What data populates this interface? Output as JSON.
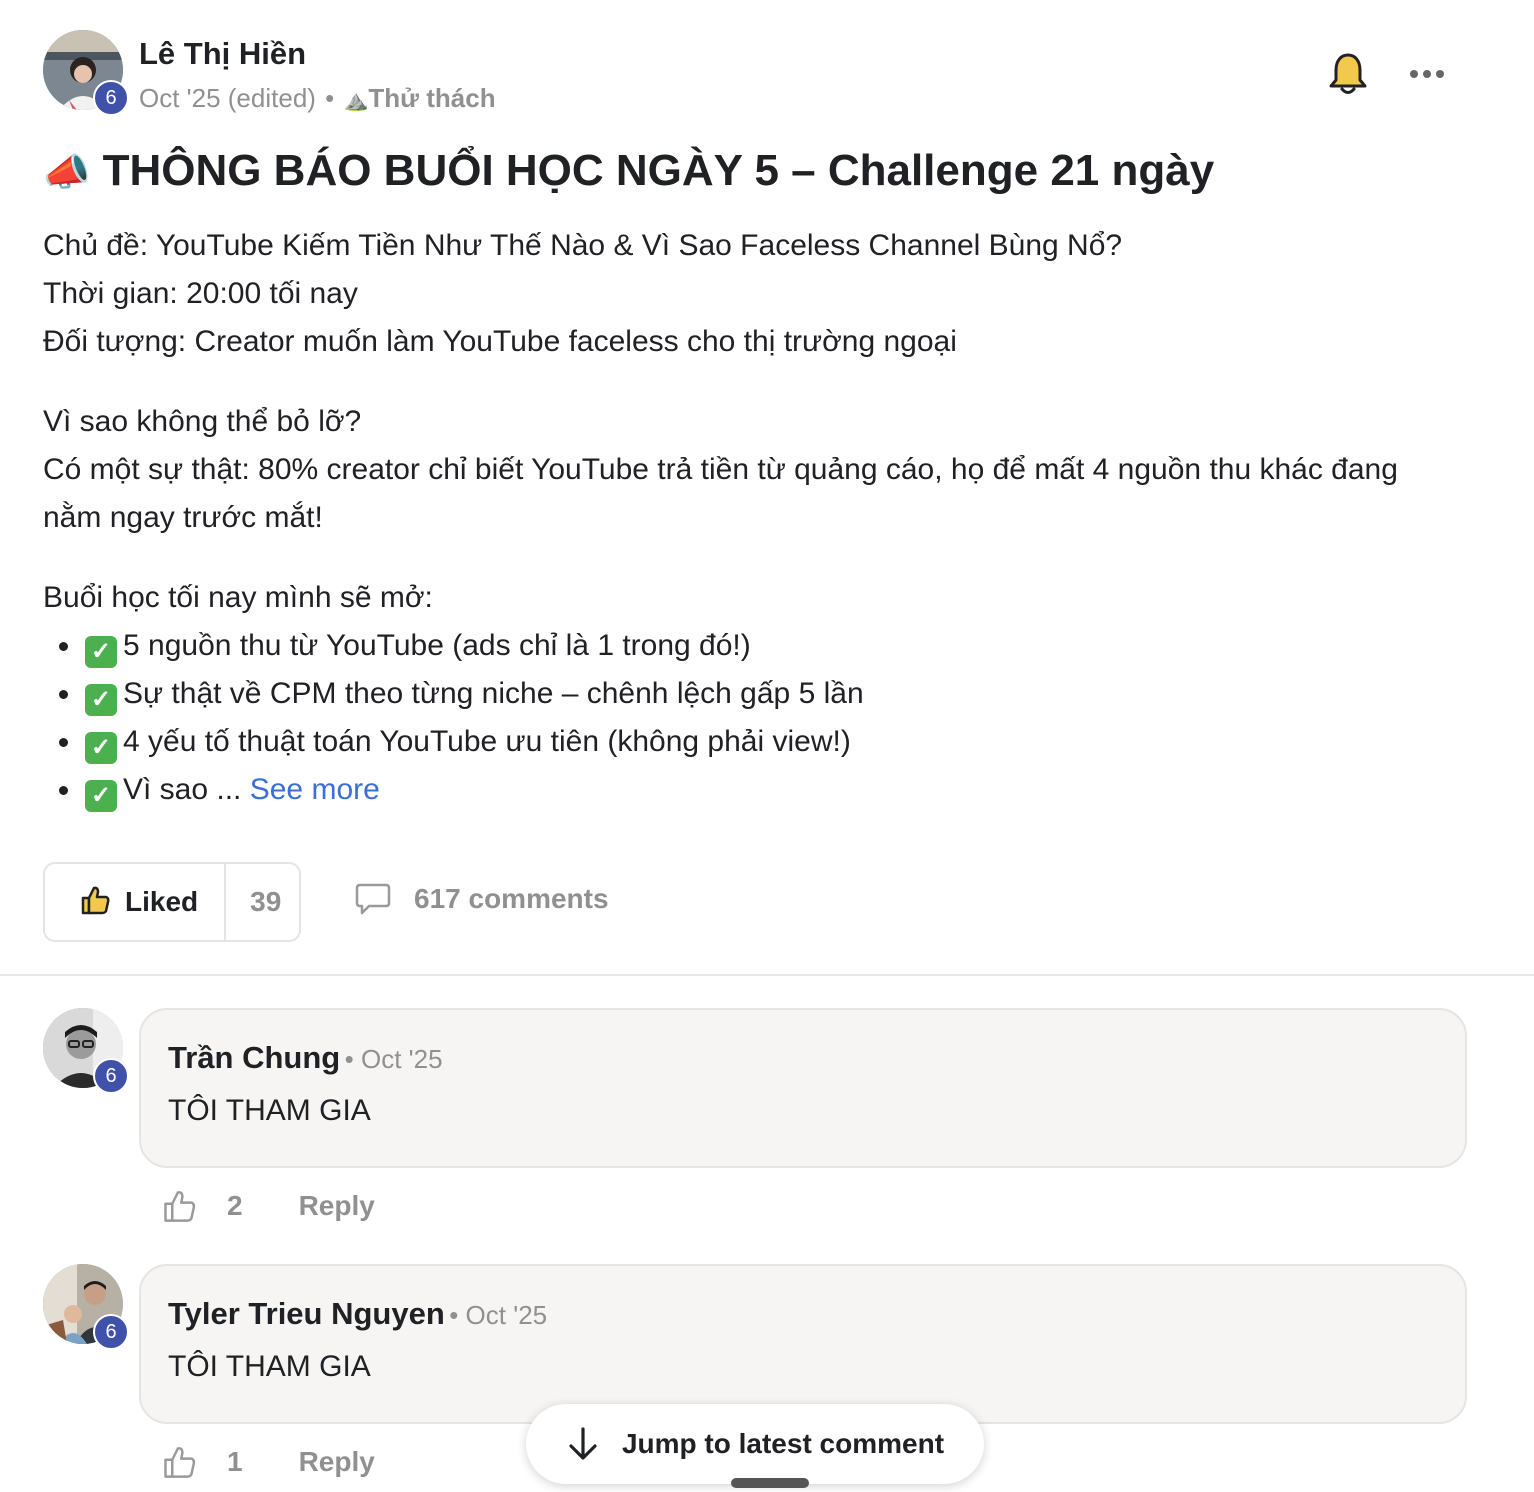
{
  "post": {
    "author": "Lê Thị Hiền",
    "level": "6",
    "date": "Oct '25 (edited)",
    "separator": "•",
    "category_icon": "⛰️",
    "category": "Thử thách",
    "title_icon": "📣",
    "title": "THÔNG BÁO BUỔI HỌC NGÀY 5 – Challenge 21 ngày",
    "lines": [
      "Chủ đề: YouTube Kiếm Tiền Như Thế Nào & Vì Sao Faceless Channel Bùng Nổ?",
      "Thời gian: 20:00 tối nay",
      "Đối tượng: Creator muốn làm YouTube faceless cho thị trường ngoại"
    ],
    "why_heading": "Vì sao không thể bỏ lỡ?",
    "why_text": "Có một sự thật: 80% creator chỉ biết YouTube trả tiền từ quảng cáo, họ để mất 4 nguồn thu khác đang nằm ngay trước mắt!",
    "list_intro": "Buổi học tối nay mình sẽ mở:",
    "bullets": [
      "5 nguồn thu từ YouTube (ads chỉ là 1 trong đó!)",
      "Sự thật về CPM theo từng niche – chênh lệch gấp 5 lần",
      "4 yếu tố thuật toán YouTube ưu tiên (không phải view!)",
      "Vì sao ..."
    ],
    "check_glyph": "✓",
    "see_more": "See more",
    "liked_label": "Liked",
    "like_count": "39",
    "comments_label": "617 comments"
  },
  "comments": [
    {
      "author": "Trần Chung",
      "level": "6",
      "date": "• Oct '25",
      "text": "TÔI THAM GIA",
      "likes": "2",
      "reply": "Reply"
    },
    {
      "author": "Tyler Trieu Nguyen",
      "level": "6",
      "date": "• Oct '25",
      "text": "TÔI THAM GIA",
      "likes": "1",
      "reply": "Reply"
    }
  ],
  "jump_label": "Jump to latest comment",
  "colors": {
    "accent_link": "#3b6fd8",
    "level_badge": "#3f51a8",
    "bell": "#f2c94c"
  }
}
